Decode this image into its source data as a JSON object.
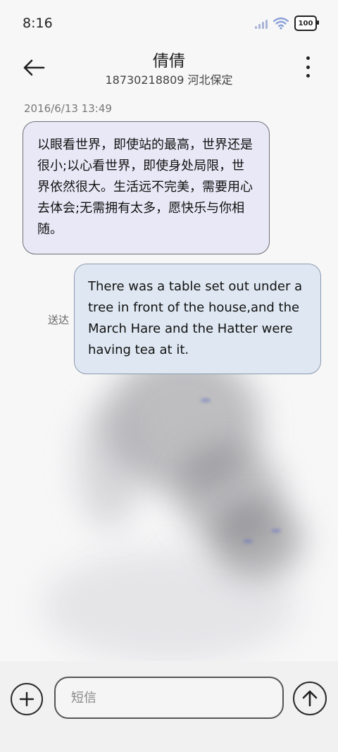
{
  "status_bar": {
    "time": "8:16",
    "battery_level": "100",
    "icons": [
      "signal-icon",
      "wifi-icon",
      "battery-icon"
    ]
  },
  "header": {
    "contact_name": "倩倩",
    "contact_detail": "18730218809 河北保定",
    "icons": [
      "back-arrow-icon",
      "more-vertical-icon"
    ]
  },
  "conversation": {
    "timestamp": "2016/6/13 13:49",
    "incoming_message": "以眼看世界，即使站的最高，世界还是很小;以心看世界，即使身处局限，世界依然很大。生活远不完美，需要用心去体会;无需拥有太多，愿快乐与你相随。",
    "outgoing_message": "There was a table set out under a tree in front of the house,and the March Hare and the Hatter were having tea at it.",
    "outgoing_status": "送达"
  },
  "composer": {
    "placeholder": "短信",
    "value": "",
    "icons": [
      "plus-icon",
      "send-arrow-up-icon"
    ]
  },
  "colors": {
    "incoming_bubble": "#e9e8f7",
    "outgoing_bubble": "#dfe8f2",
    "background": "#f7f7f8"
  }
}
